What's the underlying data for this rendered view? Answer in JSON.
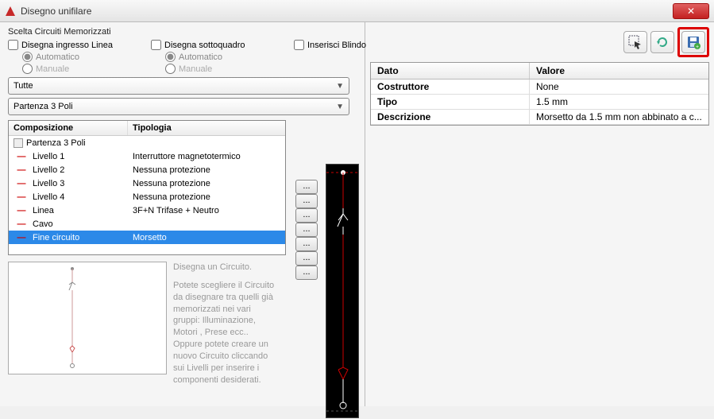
{
  "window": {
    "title": "Disegno unifilare"
  },
  "section": {
    "title": "Scelta Circuiti Memorizzati"
  },
  "checks": {
    "ingresso": "Disegna ingresso Linea",
    "sottoquadro": "Disegna sottoquadro",
    "blindo": "Inserisci Blindo",
    "automatico": "Automatico",
    "manuale": "Manuale"
  },
  "combos": {
    "group": "Tutte",
    "circuit": "Partenza 3 Poli"
  },
  "tree": {
    "headers": {
      "col1": "Composizione",
      "col2": "Tipologia"
    },
    "root": "Partenza 3 Poli",
    "rows": [
      {
        "label": "Livello 1",
        "type": "Interruttore magnetotermico"
      },
      {
        "label": "Livello 2",
        "type": "Nessuna protezione"
      },
      {
        "label": "Livello 3",
        "type": "Nessuna protezione"
      },
      {
        "label": "Livello 4",
        "type": "Nessuna protezione"
      },
      {
        "label": "Linea",
        "type": "3F+N Trifase + Neutro"
      },
      {
        "label": "Cavo",
        "type": ""
      },
      {
        "label": "Fine circuito",
        "type": "Morsetto"
      }
    ],
    "selectedIndex": 6,
    "ellipsis": "..."
  },
  "help": {
    "title": "Disegna un Circuito.",
    "body": "Potete scegliere il Circuito da disegnare tra quelli già memorizzati nei vari gruppi: Illuminazione, Motori , Prese ecc.. Oppure potete creare un nuovo Circuito cliccando sui Livelli per inserire i componenti desiderati."
  },
  "props": {
    "headers": {
      "col1": "Dato",
      "col2": "Valore"
    },
    "rows": [
      {
        "k": "Costruttore",
        "v": "None"
      },
      {
        "k": "Tipo",
        "v": "1.5 mm"
      },
      {
        "k": "Descrizione",
        "v": "Morsetto da 1.5 mm non abbinato a c..."
      }
    ]
  }
}
